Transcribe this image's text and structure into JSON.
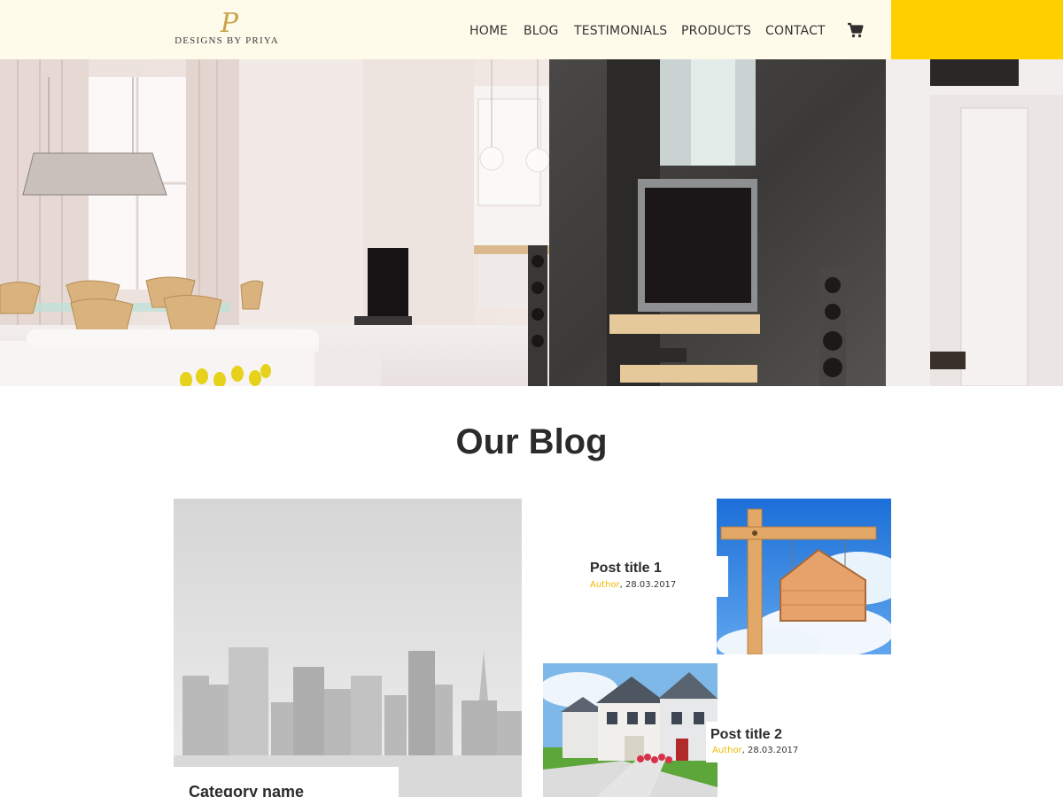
{
  "brand": {
    "logo_mark": "P",
    "logo_text": "DESIGNS BY PRIYA"
  },
  "nav": {
    "items": [
      {
        "label": "HOME"
      },
      {
        "label": "BLOG"
      },
      {
        "label": "TESTIMONIALS"
      },
      {
        "label": "PRODUCTS"
      },
      {
        "label": "CONTACT"
      }
    ],
    "cart_icon": "shopping-cart-icon"
  },
  "colors": {
    "header_bg": "#fffbeb",
    "accent": "#ffd000",
    "author": "#f2b800",
    "text": "#2b2b2b"
  },
  "blog": {
    "title": "Our Blog",
    "featured": {
      "category": "Category name"
    },
    "posts": [
      {
        "title": "Post title 1",
        "author": "Author",
        "date": ", 28.03.2017"
      },
      {
        "title": "Post title 2",
        "author": "Author",
        "date": ", 28.03.2017"
      }
    ]
  }
}
